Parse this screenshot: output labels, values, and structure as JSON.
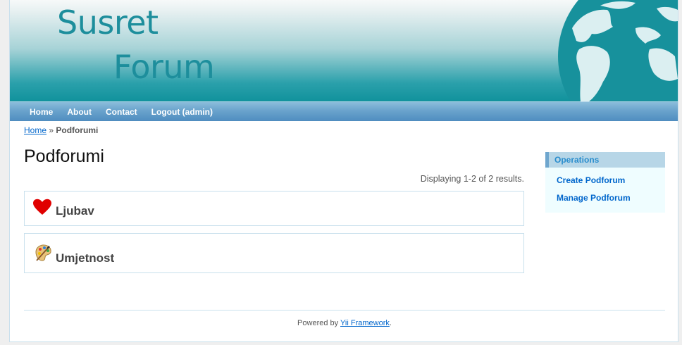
{
  "header": {
    "logo_line1": "Susret",
    "logo_line2": "Forum"
  },
  "menu": {
    "items": [
      {
        "label": "Home"
      },
      {
        "label": "About"
      },
      {
        "label": "Contact"
      },
      {
        "label": "Logout (admin)"
      }
    ]
  },
  "breadcrumbs": {
    "home": "Home",
    "separator": "»",
    "current": "Podforumi"
  },
  "main": {
    "title": "Podforumi",
    "summary": "Displaying 1-2 of 2 results.",
    "forums": [
      {
        "title": "Ljubav",
        "icon": "heart-icon"
      },
      {
        "title": "Umjetnost",
        "icon": "paint-palette-icon"
      }
    ]
  },
  "sidebar": {
    "title": "Operations",
    "links": [
      {
        "label": "Create Podforum"
      },
      {
        "label": "Manage Podforum"
      }
    ]
  },
  "footer": {
    "prefix": "Powered by",
    "link": "Yii Framework",
    "suffix": "."
  },
  "colors": {
    "accent": "#1d8e9c",
    "menu": "#6aa3cc",
    "link": "#0066cc"
  }
}
